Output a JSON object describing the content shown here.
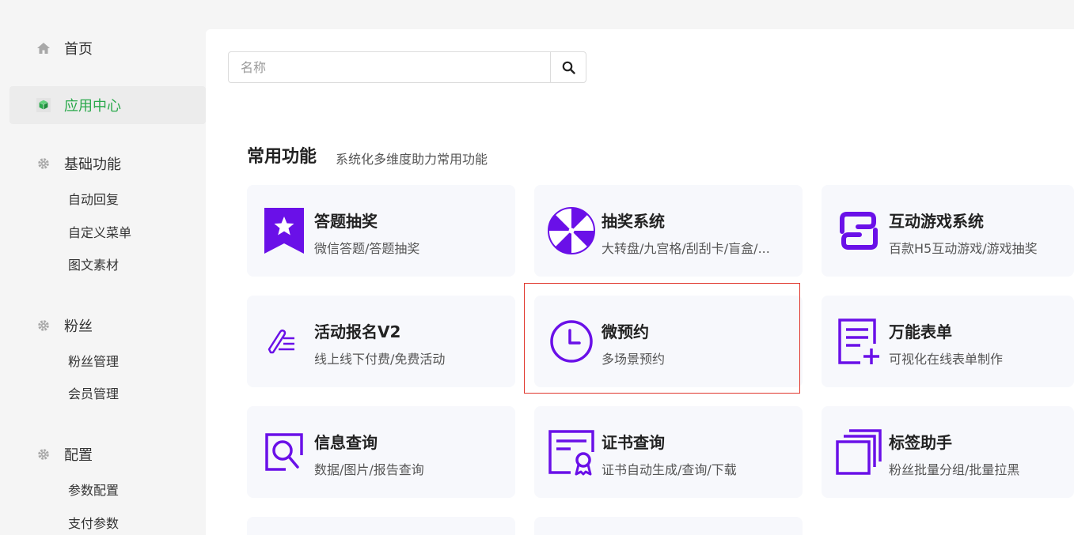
{
  "sidebar": {
    "home": "首页",
    "app_center": "应用中心",
    "basic": {
      "label": "基础功能",
      "items": [
        "自动回复",
        "自定义菜单",
        "图文素材"
      ]
    },
    "fans": {
      "label": "粉丝",
      "items": [
        "粉丝管理",
        "会员管理"
      ]
    },
    "config": {
      "label": "配置",
      "items": [
        "参数配置",
        "支付参数"
      ]
    }
  },
  "search": {
    "placeholder": "名称"
  },
  "section": {
    "title": "常用功能",
    "subtitle": "系统化多维度助力常用功能"
  },
  "cards": [
    {
      "title": "答题抽奖",
      "desc": "微信答题/答题抽奖",
      "icon": "ribbon-star-icon"
    },
    {
      "title": "抽奖系统",
      "desc": "大转盘/九宫格/刮刮卡/盲盒/...",
      "icon": "wheel-icon"
    },
    {
      "title": "互动游戏系统",
      "desc": "百款H5互动游戏/游戏抽奖",
      "icon": "link-icon"
    },
    {
      "title": "活动报名V2",
      "desc": "线上线下付费/免费活动",
      "icon": "pen-list-icon"
    },
    {
      "title": "微预约",
      "desc": "多场景预约",
      "icon": "clock-icon"
    },
    {
      "title": "万能表单",
      "desc": "可视化在线表单制作",
      "icon": "form-add-icon"
    },
    {
      "title": "信息查询",
      "desc": "数据/图片/报告查询",
      "icon": "search-doc-icon"
    },
    {
      "title": "证书查询",
      "desc": "证书自动生成/查询/下载",
      "icon": "certificate-icon"
    },
    {
      "title": "标签助手",
      "desc": "粉丝批量分组/批量拉黑",
      "icon": "stack-icon"
    }
  ],
  "colors": {
    "accent": "#6a10e8",
    "active_nav": "#2aa94b",
    "highlight": "#e0362c"
  }
}
